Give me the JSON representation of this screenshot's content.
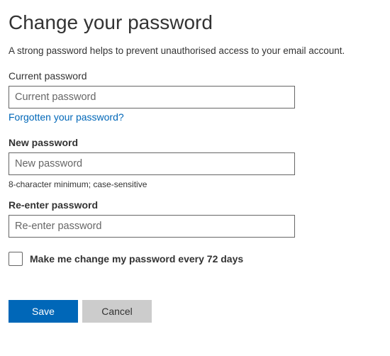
{
  "title": "Change your password",
  "intro": "A strong password helps to prevent unauthorised access to your email account.",
  "current": {
    "label": "Current password",
    "placeholder": "Current password",
    "value": ""
  },
  "forgot_link": "Forgotten your password?",
  "new": {
    "label": "New password",
    "placeholder": "New password",
    "value": ""
  },
  "hint": "8-character minimum; case-sensitive",
  "reenter": {
    "label": "Re-enter password",
    "placeholder": "Re-enter password",
    "value": ""
  },
  "periodic": {
    "checked": false,
    "label": "Make me change my password every 72 days"
  },
  "buttons": {
    "save": "Save",
    "cancel": "Cancel"
  }
}
